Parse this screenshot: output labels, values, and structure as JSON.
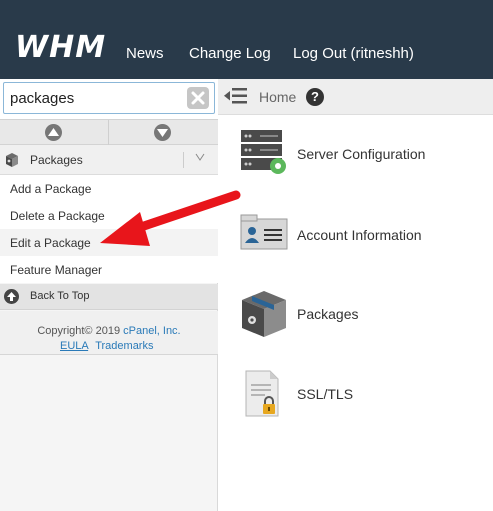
{
  "header": {
    "logo_text": "WHM",
    "nav": [
      "News",
      "Change Log",
      "Log Out (ritneshh)"
    ]
  },
  "sidebar": {
    "search": {
      "value": "packages",
      "clear_icon": "clear-icon"
    },
    "category": {
      "label": "Packages",
      "icon": "package-icon"
    },
    "items": [
      {
        "label": "Add a Package"
      },
      {
        "label": "Delete a Package"
      },
      {
        "label": "Edit a Package"
      },
      {
        "label": "Feature Manager"
      }
    ],
    "back_to_top": "Back To Top",
    "footer": {
      "copyright_prefix": "Copyright© 2019",
      "copyright_link": "cPanel, Inc.",
      "eula": "EULA",
      "trademarks": "Trademarks"
    }
  },
  "breadcrumb": {
    "home": "Home"
  },
  "main": {
    "items": [
      {
        "label": "Server Configuration",
        "icon": "server-configuration-icon"
      },
      {
        "label": "Account Information",
        "icon": "account-information-icon"
      },
      {
        "label": "Packages",
        "icon": "packages-icon"
      },
      {
        "label": "SSL/TLS",
        "icon": "ssl-tls-icon"
      }
    ]
  },
  "colors": {
    "topbar": "#293a4a",
    "link": "#2a7ab8",
    "annotation_arrow": "#e8151b",
    "gear_green": "#5cb85c"
  }
}
